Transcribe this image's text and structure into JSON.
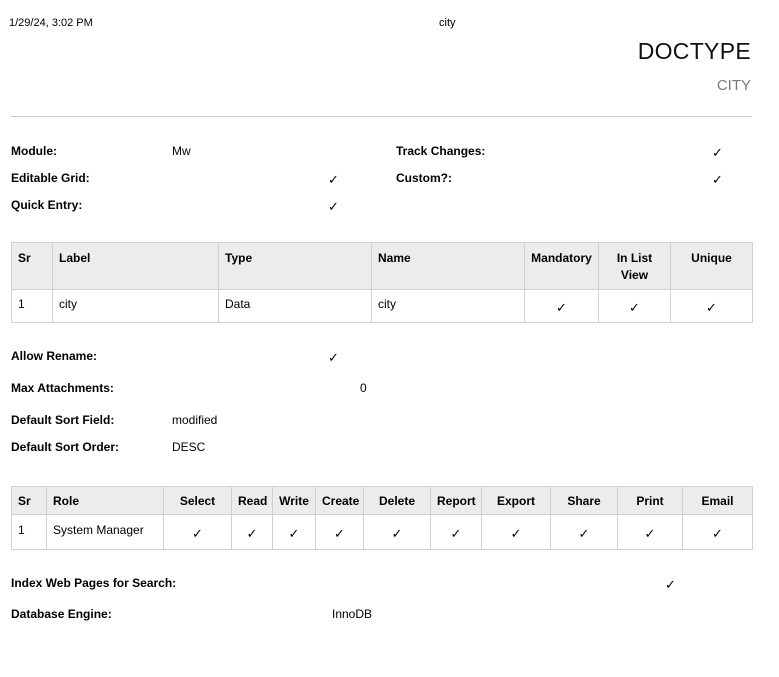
{
  "header": {
    "print_date": "1/29/24, 3:02 PM",
    "print_title": "city",
    "heading": "DOCTYPE",
    "subtitle": "CITY"
  },
  "check_mark": "✓",
  "properties_top": {
    "module_label": "Module:",
    "module_value": "Mw",
    "track_changes_label": "Track Changes:",
    "editable_grid_label": "Editable Grid:",
    "custom_label": "Custom?:",
    "quick_entry_label": "Quick Entry:"
  },
  "fields_table": {
    "headers": [
      "Sr",
      "Label",
      "Type",
      "Name",
      "Mandatory",
      "In List View",
      "Unique"
    ],
    "rows": [
      {
        "sr": "1",
        "label": "city",
        "type": "Data",
        "name": "city",
        "mandatory": true,
        "in_list_view": true,
        "unique": true
      }
    ]
  },
  "properties_mid": {
    "allow_rename_label": "Allow Rename:",
    "max_attachments_label": "Max Attachments:",
    "max_attachments_value": "0",
    "default_sort_field_label": "Default Sort Field:",
    "default_sort_field_value": "modified",
    "default_sort_order_label": "Default Sort Order:",
    "default_sort_order_value": "DESC"
  },
  "permissions_table": {
    "headers": [
      "Sr",
      "Role",
      "Select",
      "Read",
      "Write",
      "Create",
      "Delete",
      "Report",
      "Export",
      "Share",
      "Print",
      "Email"
    ],
    "rows": [
      {
        "sr": "1",
        "role": "System Manager",
        "select": true,
        "read": true,
        "write": true,
        "create": true,
        "delete": true,
        "report": true,
        "export": true,
        "share": true,
        "print": true,
        "email": true
      }
    ]
  },
  "properties_bottom": {
    "index_web_pages_label": "Index Web Pages for Search:",
    "database_engine_label": "Database Engine:",
    "database_engine_value": "InnoDB"
  }
}
